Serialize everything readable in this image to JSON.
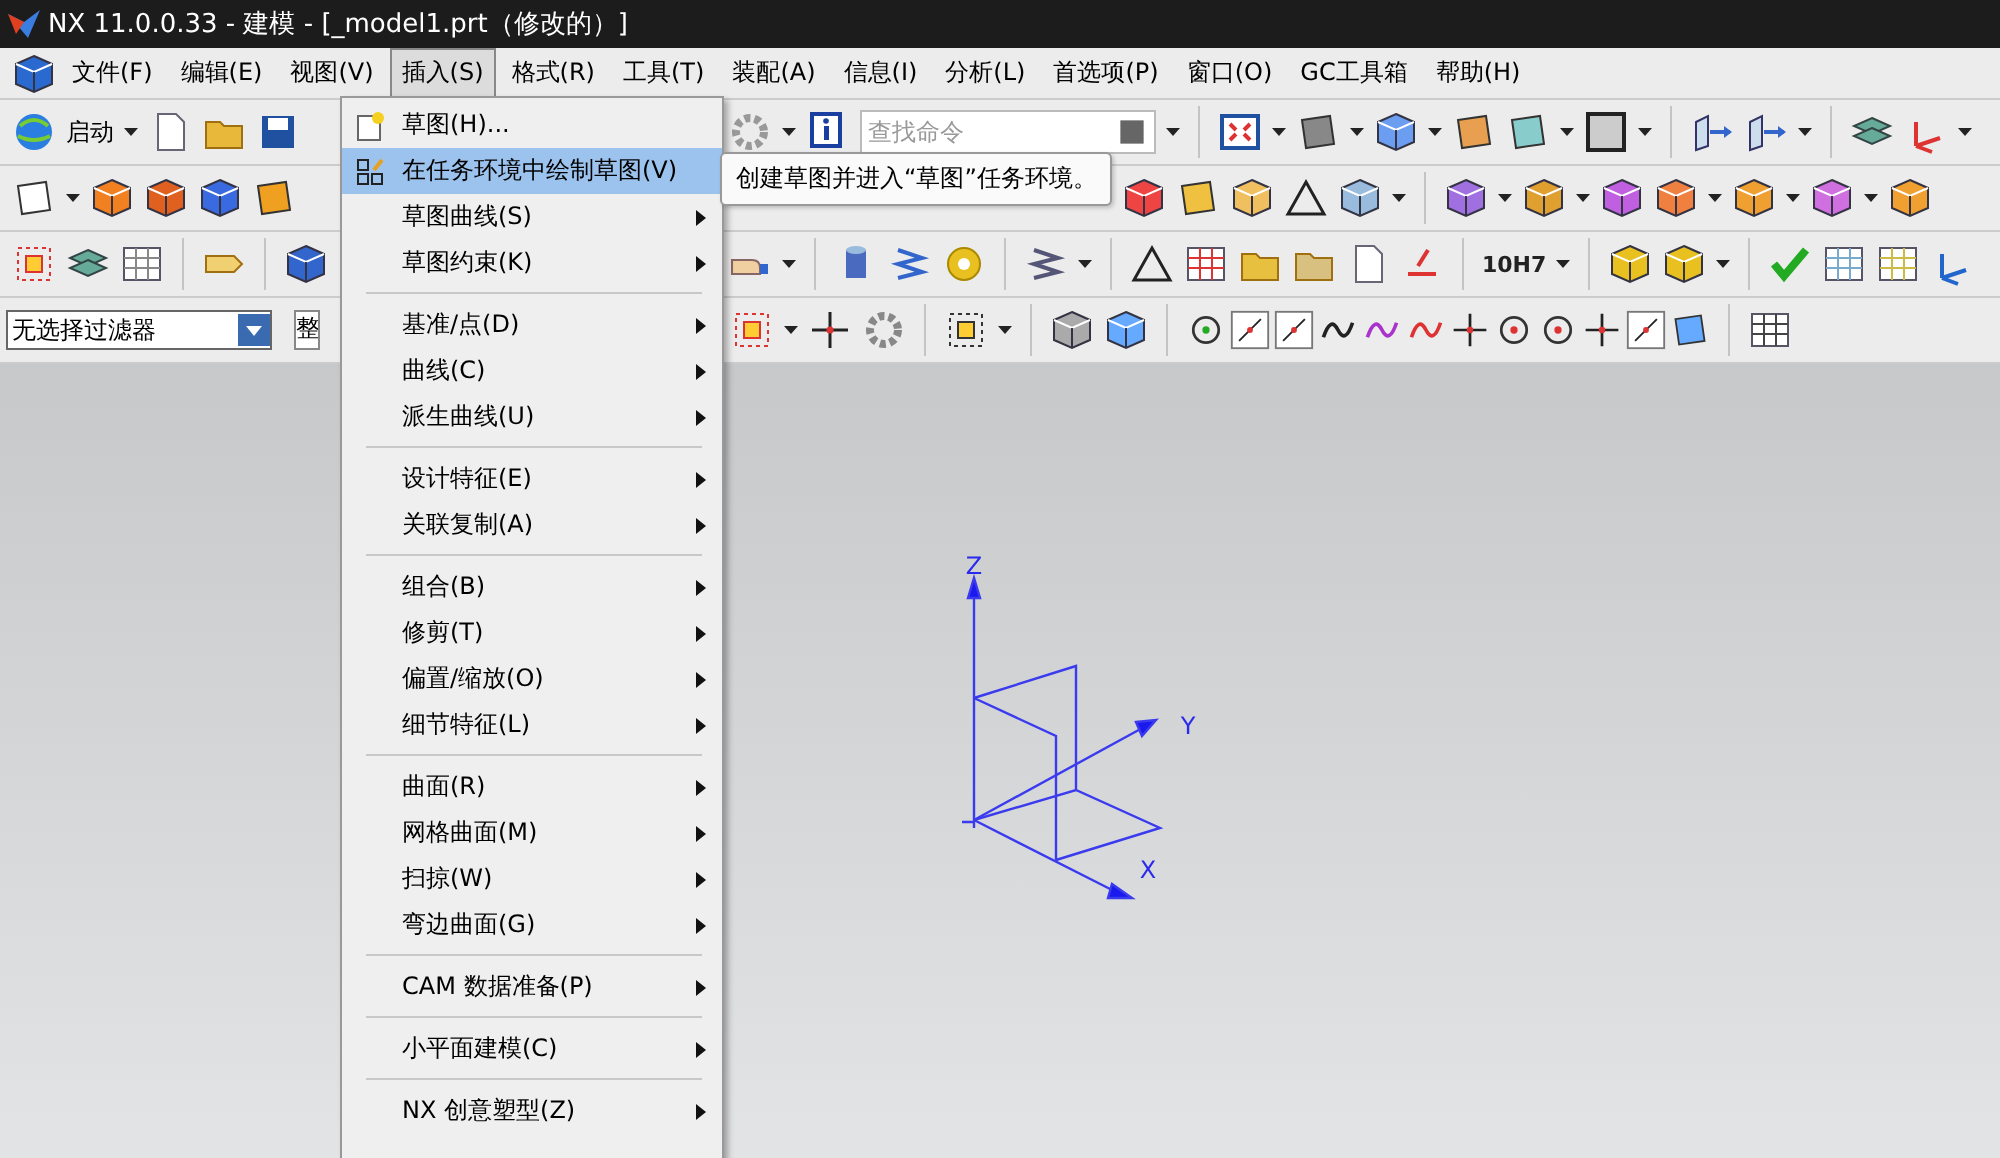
{
  "window": {
    "title": "NX 11.0.0.33 - 建模 - [_model1.prt（修改的）]"
  },
  "menubar": [
    {
      "label": "文件(F)",
      "selected": false
    },
    {
      "label": "编辑(E)",
      "selected": false
    },
    {
      "label": "视图(V)",
      "selected": false
    },
    {
      "label": "插入(S)",
      "selected": true
    },
    {
      "label": "格式(R)",
      "selected": false
    },
    {
      "label": "工具(T)",
      "selected": false
    },
    {
      "label": "装配(A)",
      "selected": false
    },
    {
      "label": "信息(I)",
      "selected": false
    },
    {
      "label": "分析(L)",
      "selected": false
    },
    {
      "label": "首选项(P)",
      "selected": false
    },
    {
      "label": "窗口(O)",
      "selected": false
    },
    {
      "label": "GC工具箱",
      "selected": false
    },
    {
      "label": "帮助(H)",
      "selected": false
    }
  ],
  "toolbar": {
    "start_label": "启动",
    "search": {
      "placeholder": "查找命令"
    },
    "tolerance_label": "10H7",
    "filter": {
      "value": "无选择过滤器"
    },
    "scope_field": {
      "value": "整"
    }
  },
  "insert_menu": [
    {
      "kind": "item",
      "label": "草图(H)...",
      "submenu": false,
      "selected": false
    },
    {
      "kind": "item",
      "label": "在任务环境中绘制草图(V)",
      "submenu": false,
      "selected": true
    },
    {
      "kind": "item",
      "label": "草图曲线(S)",
      "submenu": true,
      "selected": false
    },
    {
      "kind": "item",
      "label": "草图约束(K)",
      "submenu": true,
      "selected": false
    },
    {
      "kind": "separator"
    },
    {
      "kind": "item",
      "label": "基准/点(D)",
      "submenu": true,
      "selected": false
    },
    {
      "kind": "item",
      "label": "曲线(C)",
      "submenu": true,
      "selected": false
    },
    {
      "kind": "item",
      "label": "派生曲线(U)",
      "submenu": true,
      "selected": false
    },
    {
      "kind": "separator"
    },
    {
      "kind": "item",
      "label": "设计特征(E)",
      "submenu": true,
      "selected": false
    },
    {
      "kind": "item",
      "label": "关联复制(A)",
      "submenu": true,
      "selected": false
    },
    {
      "kind": "separator"
    },
    {
      "kind": "item",
      "label": "组合(B)",
      "submenu": true,
      "selected": false
    },
    {
      "kind": "item",
      "label": "修剪(T)",
      "submenu": true,
      "selected": false
    },
    {
      "kind": "item",
      "label": "偏置/缩放(O)",
      "submenu": true,
      "selected": false
    },
    {
      "kind": "item",
      "label": "细节特征(L)",
      "submenu": true,
      "selected": false
    },
    {
      "kind": "separator"
    },
    {
      "kind": "item",
      "label": "曲面(R)",
      "submenu": true,
      "selected": false
    },
    {
      "kind": "item",
      "label": "网格曲面(M)",
      "submenu": true,
      "selected": false
    },
    {
      "kind": "item",
      "label": "扫掠(W)",
      "submenu": true,
      "selected": false
    },
    {
      "kind": "item",
      "label": "弯边曲面(G)",
      "submenu": true,
      "selected": false
    },
    {
      "kind": "separator"
    },
    {
      "kind": "item",
      "label": "CAM 数据准备(P)",
      "submenu": true,
      "selected": false
    },
    {
      "kind": "separator"
    },
    {
      "kind": "item",
      "label": "小平面建模(C)",
      "submenu": true,
      "selected": false
    },
    {
      "kind": "separator"
    },
    {
      "kind": "item",
      "label": "NX 创意塑型(Z)",
      "submenu": true,
      "selected": false
    }
  ],
  "tooltip": {
    "text": "创建草图并进入“草图”任务环境。"
  },
  "triad": {
    "axes": [
      {
        "label": "Z"
      },
      {
        "label": "Y"
      },
      {
        "label": "X"
      }
    ]
  }
}
